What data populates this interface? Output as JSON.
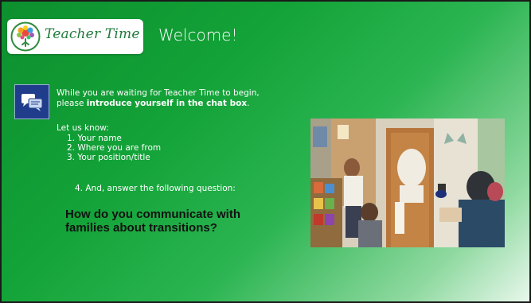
{
  "logo": {
    "text": "Teacher Time"
  },
  "slide": {
    "title": "Welcome!"
  },
  "intro": {
    "line_start": "While you are waiting for Teacher Time to begin,",
    "line2_prefix": "please ",
    "line2_bold": "introduce yourself in the chat box",
    "line2_suffix": "."
  },
  "prompt": {
    "label": "Let us know:",
    "items": [
      "1. Your name",
      "2. Where you are from",
      "3. Your position/title"
    ],
    "item4": "4.   And, answer the following question:",
    "question": "How do you communicate with families about transitions?"
  },
  "icons": {
    "chat": "chat-bubbles-icon",
    "logo": "tree-emblem-icon"
  },
  "colors": {
    "background_green": "#13a338",
    "chat_icon_bg": "#1f3d8a",
    "logo_text": "#1f7a3a"
  }
}
